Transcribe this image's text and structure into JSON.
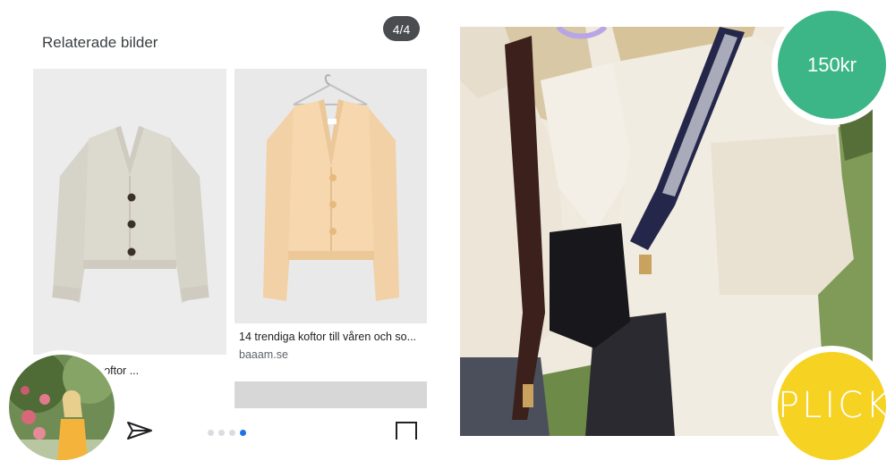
{
  "related": {
    "title": "Relaterade bilder",
    "counter": "4/4",
    "cards": [
      {
        "caption": "de tröjor och koftor ...",
        "source": ""
      },
      {
        "caption": "14 trendiga koftor till våren och so...",
        "source": "baaam.se"
      }
    ],
    "pagination": {
      "total": 4,
      "active_index": 3
    },
    "icons": {
      "share": "share-icon",
      "square": "square-icon"
    }
  },
  "photo": {
    "description_icon": "listing-photo"
  },
  "price": {
    "label": "150kr",
    "color": "#3cb686"
  },
  "brand": {
    "label": "PLICK",
    "color": "#f6d223"
  },
  "profile": {
    "icon": "avatar"
  }
}
